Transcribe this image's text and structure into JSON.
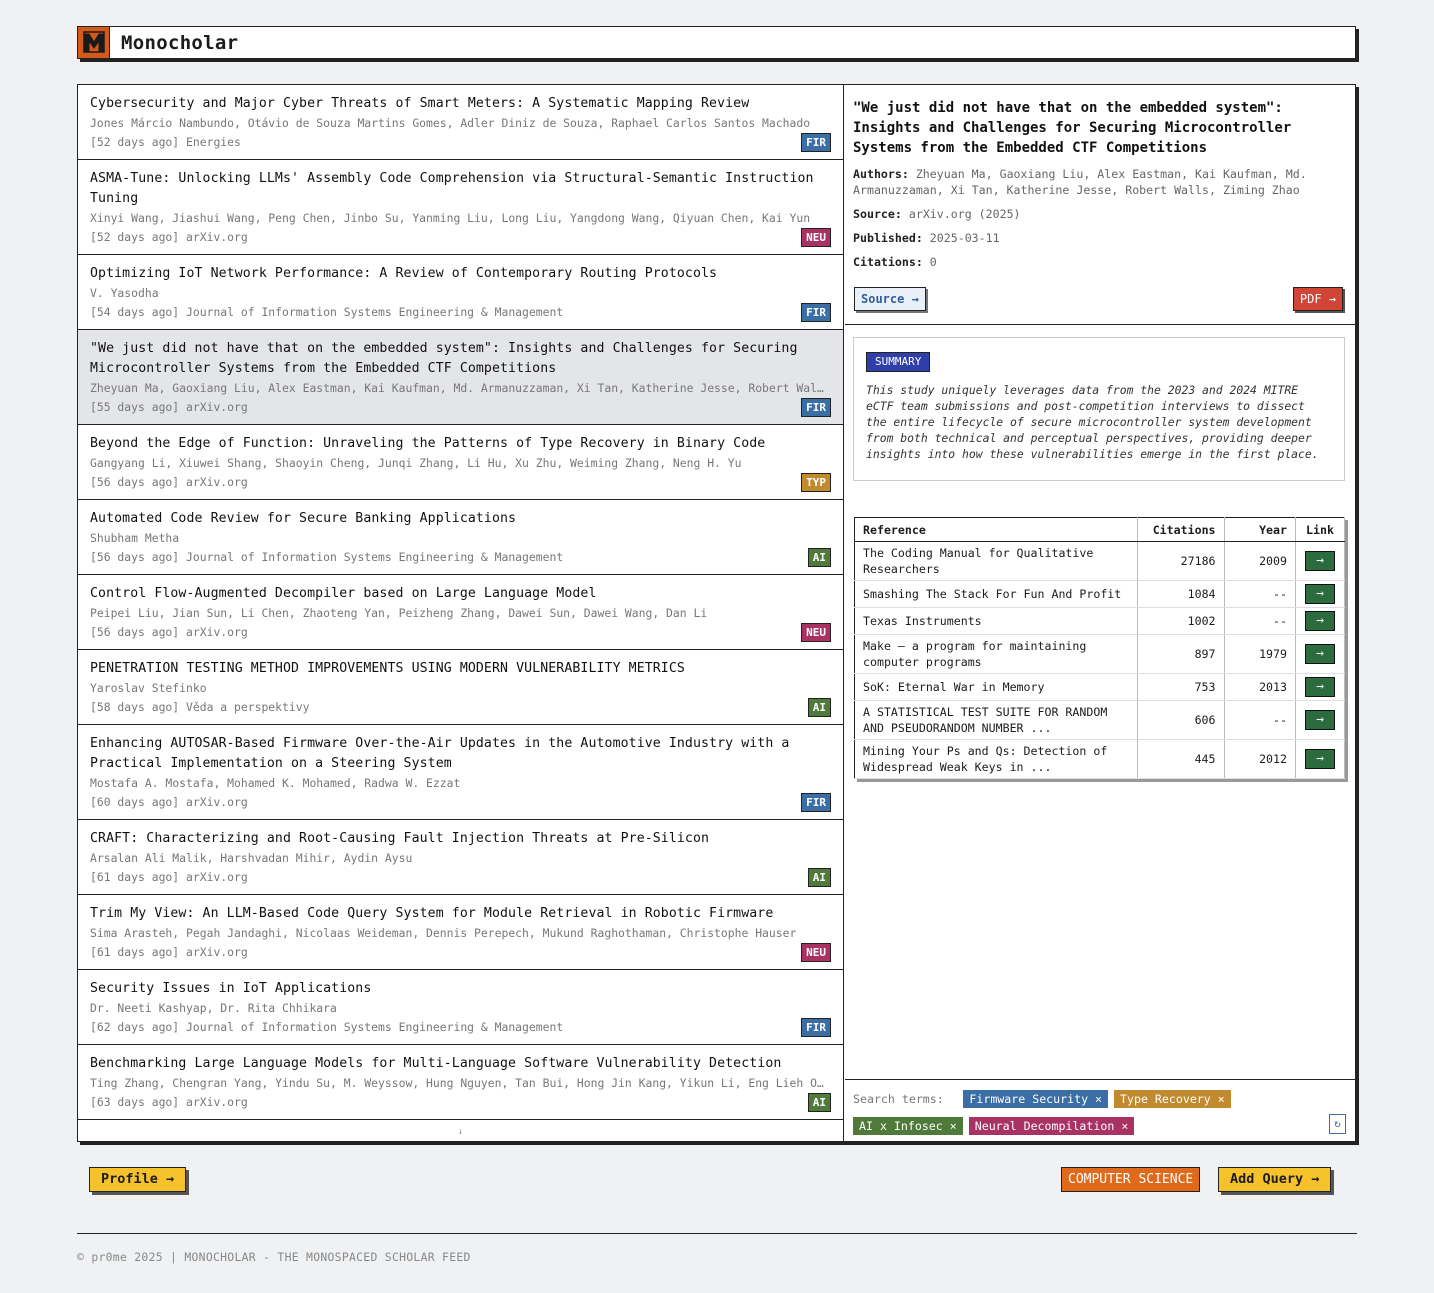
{
  "app": {
    "title": "Monocholar"
  },
  "feed": [
    {
      "title": "Cybersecurity and Major Cyber Threats of Smart Meters: A Systematic Mapping Review",
      "authors": "Jones Márcio Nambundo, Otávio de Souza Martins Gomes, Adler Diniz de Souza, Raphael Carlos Santos Machado",
      "meta": "[52 days ago] Energies",
      "tag": "FIR"
    },
    {
      "title": "ASMA-Tune: Unlocking LLMs' Assembly Code Comprehension via Structural-Semantic Instruction Tuning",
      "authors": "Xinyi Wang, Jiashui Wang, Peng Chen, Jinbo Su, Yanming Liu, Long Liu, Yangdong Wang, Qiyuan Chen, Kai Yun",
      "meta": "[52 days ago] arXiv.org",
      "tag": "NEU"
    },
    {
      "title": "Optimizing IoT Network Performance: A Review of Contemporary Routing Protocols",
      "authors": "V. Yasodha",
      "meta": "[54 days ago] Journal of Information Systems Engineering & Management",
      "tag": "FIR"
    },
    {
      "title": "\"We just did not have that on the embedded system\": Insights and Challenges for Securing Microcontroller Systems from the Embedded CTF Competitions",
      "authors": "Zheyuan Ma, Gaoxiang Liu, Alex Eastman, Kai Kaufman, Md. Armanuzzaman, Xi Tan, Katherine Jesse, Robert Walls, Ziming Zhao",
      "meta": "[55 days ago] arXiv.org",
      "tag": "FIR"
    },
    {
      "title": "Beyond the Edge of Function: Unraveling the Patterns of Type Recovery in Binary Code",
      "authors": "Gangyang Li, Xiuwei Shang, Shaoyin Cheng, Junqi Zhang, Li Hu, Xu Zhu, Weiming Zhang, Neng H. Yu",
      "meta": "[56 days ago] arXiv.org",
      "tag": "TYP"
    },
    {
      "title": "Automated Code Review for Secure Banking Applications",
      "authors": "Shubham Metha",
      "meta": "[56 days ago] Journal of Information Systems Engineering & Management",
      "tag": "AI"
    },
    {
      "title": "Control Flow-Augmented Decompiler based on Large Language Model",
      "authors": "Peipei Liu, Jian Sun, Li Chen, Zhaoteng Yan, Peizheng Zhang, Dawei Sun, Dawei Wang, Dan Li",
      "meta": "[56 days ago] arXiv.org",
      "tag": "NEU"
    },
    {
      "title": "PENETRATION TESTING METHOD IMPROVEMENTS USING MODERN VULNERABILITY METRICS",
      "authors": "Yaroslav Stefinko",
      "meta": "[58 days ago] Věda a perspektivy",
      "tag": "AI"
    },
    {
      "title": "Enhancing AUTOSAR-Based Firmware Over-the-Air Updates in the Automotive Industry with a Practical Implementation on a Steering System",
      "authors": "Mostafa A. Mostafa, Mohamed K. Mohamed, Radwa W. Ezzat",
      "meta": "[60 days ago] arXiv.org",
      "tag": "FIR"
    },
    {
      "title": "CRAFT: Characterizing and Root-Causing Fault Injection Threats at Pre-Silicon",
      "authors": "Arsalan Ali Malik, Harshvadan Mihir, Aydin Aysu",
      "meta": "[61 days ago] arXiv.org",
      "tag": "AI"
    },
    {
      "title": "Trim My View: An LLM-Based Code Query System for Module Retrieval in Robotic Firmware",
      "authors": "Sima Arasteh, Pegah Jandaghi, Nicolaas Weideman, Dennis Perepech, Mukund Raghothaman, Christophe Hauser",
      "meta": "[61 days ago] arXiv.org",
      "tag": "NEU"
    },
    {
      "title": "Security Issues in IoT Applications",
      "authors": "Dr. Neeti Kashyap, Dr. Rita Chhikara",
      "meta": "[62 days ago] Journal of Information Systems Engineering & Management",
      "tag": "FIR"
    },
    {
      "title": "Benchmarking Large Language Models for Multi-Language Software Vulnerability Detection",
      "authors": "Ting Zhang, Chengran Yang, Yindu Su, M. Weyssow, Hung Nguyen, Tan Bui, Hong Jin Kang, Yikun Li, Eng Lieh Ouh",
      "meta": "[63 days ago] arXiv.org",
      "tag": "AI"
    }
  ],
  "feed_footer": "↓",
  "detail": {
    "title": "\"We just did not have that on the embedded system\": Insights and Challenges for Securing Microcontroller Systems from the Embedded CTF Competitions",
    "authors_label": "Authors:",
    "authors": "Zheyuan Ma, Gaoxiang Liu, Alex Eastman, Kai Kaufman, Md. Armanuzzaman, Xi Tan, Katherine Jesse, Robert Walls, Ziming Zhao",
    "source_label": "Source:",
    "source": "arXiv.org (2025)",
    "published_label": "Published:",
    "published": "2025-03-11",
    "citations_label": "Citations:",
    "citations": "0",
    "source_button": "Source →",
    "pdf_button": "PDF →",
    "summary_label": "SUMMARY",
    "summary": "This study uniquely leverages data from the 2023 and 2024 MITRE eCTF team submissions and post-competition interviews to dissect the entire lifecycle of secure microcontroller system development from both technical and perceptual perspectives, providing deeper insights into how these vulnerabilities emerge in the first place."
  },
  "references": {
    "headers": [
      "Reference",
      "Citations",
      "Year",
      "Link"
    ],
    "rows": [
      {
        "ref": "The Coding Manual for Qualitative Researchers",
        "citations": "27186",
        "year": "2009"
      },
      {
        "ref": "Smashing The Stack For Fun And Profit",
        "citations": "1084",
        "year": "--"
      },
      {
        "ref": "Texas Instruments",
        "citations": "1002",
        "year": "--"
      },
      {
        "ref": "Make — a program for maintaining computer programs",
        "citations": "897",
        "year": "1979"
      },
      {
        "ref": "SoK: Eternal War in Memory",
        "citations": "753",
        "year": "2013"
      },
      {
        "ref": "A STATISTICAL TEST SUITE FOR RANDOM AND PSEUDORANDOM NUMBER ...",
        "citations": "606",
        "year": "--"
      },
      {
        "ref": "Mining Your Ps and Qs: Detection of Widespread Weak Keys in ...",
        "citations": "445",
        "year": "2012"
      }
    ],
    "link_glyph": "→"
  },
  "search_terms": {
    "label": "Search terms:",
    "chips": [
      {
        "label": "Firmware Security ×",
        "color": "blue"
      },
      {
        "label": "Type Recovery ×",
        "color": "orange"
      },
      {
        "label": "AI x Infosec ×",
        "color": "green"
      },
      {
        "label": "Neural Decompilation ×",
        "color": "pink"
      }
    ],
    "refresh_glyph": "↻"
  },
  "actions": {
    "profile": "Profile →",
    "category": "COMPUTER SCIENCE",
    "add_query": "Add Query →"
  },
  "footer": "© pr0me 2025 | MONOCHOLAR - THE MONOSPACED SCHOLAR FEED",
  "colors": {
    "accent": "#d45a1c",
    "yellow": "#f6c22c",
    "fir": "#3a6ea5",
    "neu": "#a83263",
    "typ": "#c28a2e",
    "ai": "#4f7a3a"
  }
}
